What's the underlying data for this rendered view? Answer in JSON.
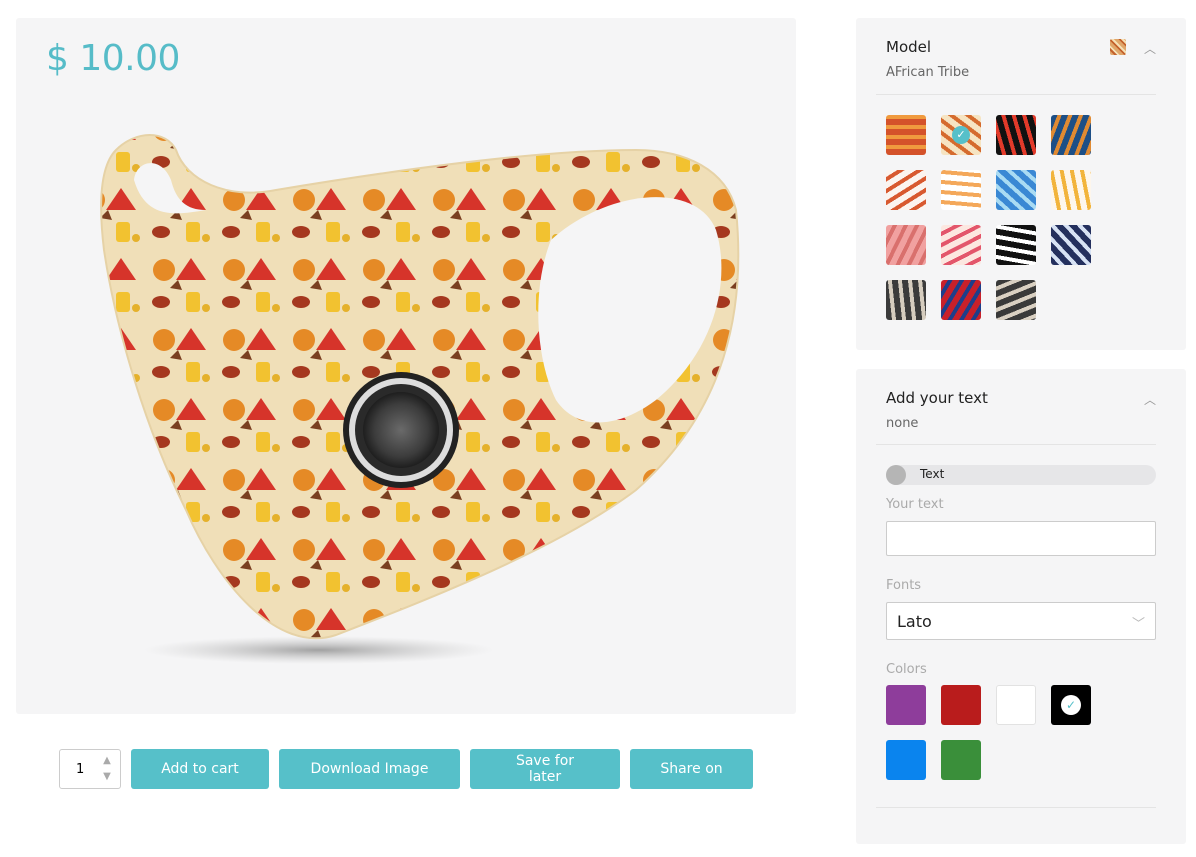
{
  "product": {
    "price": "$ 10.00"
  },
  "actions": {
    "quantity": "1",
    "add_to_cart": "Add to cart",
    "download_image": "Download Image",
    "save_for_later": "Save for later",
    "share_on": "Share on"
  },
  "model_panel": {
    "title": "Model",
    "selected": "AFrican Tribe",
    "chevron_icon": "chevron-up-icon",
    "patterns": [
      {
        "name": "orange-spiral",
        "c1": "#d4522a",
        "c2": "#f09a3e",
        "selected": false
      },
      {
        "name": "african-tribe",
        "c1": "#f6e4c2",
        "c2": "#d56b2e",
        "selected": true
      },
      {
        "name": "black-tribal",
        "c1": "#111111",
        "c2": "#e23a2a",
        "selected": false
      },
      {
        "name": "blue-orange-circles",
        "c1": "#1d4f86",
        "c2": "#e08a32",
        "selected": false
      },
      {
        "name": "food-pattern",
        "c1": "#fbf4ef",
        "c2": "#d8592f",
        "selected": false
      },
      {
        "name": "dots-pattern",
        "c1": "#ffffff",
        "c2": "#f4a85a",
        "selected": false
      },
      {
        "name": "blue-watercolor",
        "c1": "#3a88d4",
        "c2": "#a9dbf3",
        "selected": false
      },
      {
        "name": "cherries",
        "c1": "#fdf6ec",
        "c2": "#f2b43b",
        "selected": false
      },
      {
        "name": "paw-prints",
        "c1": "#f1a1a0",
        "c2": "#d9706d",
        "selected": false
      },
      {
        "name": "pink-shapes",
        "c1": "#fce7e0",
        "c2": "#e3566b",
        "selected": false
      },
      {
        "name": "black-white-green",
        "c1": "#111111",
        "c2": "#ffffff",
        "selected": false
      },
      {
        "name": "op-art-waves",
        "c1": "#24305e",
        "c2": "#d7e2f4",
        "selected": false
      },
      {
        "name": "camo-grey",
        "c1": "#3b3b3b",
        "c2": "#d6cdbf",
        "selected": false
      },
      {
        "name": "spider-man",
        "c1": "#c8202a",
        "c2": "#1e3e8a",
        "selected": false
      },
      {
        "name": "camo-grey-2",
        "c1": "#3a3a3a",
        "c2": "#d9d0c2",
        "selected": false
      }
    ]
  },
  "text_panel": {
    "title": "Add your text",
    "value": "none",
    "toggle_label": "Text",
    "your_text_label": "Your text",
    "your_text_value": "",
    "fonts_label": "Fonts",
    "font_value": "Lato",
    "colors_label": "Colors",
    "colors": [
      {
        "hex": "#8e3d9b",
        "selected": false
      },
      {
        "hex": "#b91c1c",
        "selected": false
      },
      {
        "hex": "#ffffff",
        "selected": false
      },
      {
        "hex": "#000000",
        "selected": true
      },
      {
        "hex": "#0a84ee",
        "selected": false
      },
      {
        "hex": "#3a8f3a",
        "selected": false
      }
    ]
  }
}
